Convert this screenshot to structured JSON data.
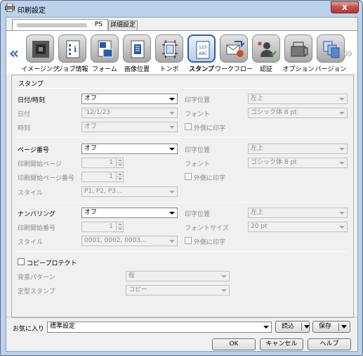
{
  "window": {
    "title": "印刷設定",
    "close_label": "x"
  },
  "tabs": [
    {
      "label": "PS"
    },
    {
      "label": "詳細設定"
    }
  ],
  "categories": [
    {
      "label": "イメージング",
      "icon": "imaging-icon"
    },
    {
      "label": "ジョブ情報",
      "icon": "job-info-icon"
    },
    {
      "label": "フォーム",
      "icon": "form-icon"
    },
    {
      "label": "画像位置",
      "icon": "image-position-icon"
    },
    {
      "label": "トンボ",
      "icon": "crop-marks-icon"
    },
    {
      "label": "スタンプ",
      "icon": "stamp-icon",
      "active": true
    },
    {
      "label": "ワークフロー",
      "icon": "workflow-icon"
    },
    {
      "label": "認証",
      "icon": "authentication-icon"
    },
    {
      "label": "オプション",
      "icon": "option-icon"
    },
    {
      "label": "バージョン",
      "icon": "version-icon"
    }
  ],
  "nav": {
    "left": "«",
    "right": "»"
  },
  "panel": {
    "title": "スタンプ",
    "datetime": {
      "label": "日付/時刻",
      "value": "オフ",
      "date_label": "日付",
      "date_value": "'12/1/23",
      "time_label": "時刻",
      "time_value": "オフ",
      "position_label": "印字位置",
      "position_value": "左上",
      "font_label": "フォント",
      "font_value": "ゴシック体 8 pt",
      "outside_label": "外側に印字"
    },
    "page_number": {
      "label": "ページ番号",
      "value": "オフ",
      "start_page_label": "印刷開始ページ",
      "start_page_value": "1",
      "start_number_label": "印刷開始ページ番号",
      "start_number_value": "1",
      "style_label": "スタイル",
      "style_value": "P1, P2, P3...",
      "position_label": "印字位置",
      "position_value": "左上",
      "font_label": "フォント",
      "font_value": "ゴシック体 8 pt",
      "outside_label": "外側に印字"
    },
    "numbering": {
      "label": "ナンバリング",
      "value": "オフ",
      "start_label": "印刷開始番号",
      "start_value": "1",
      "style_label": "スタイル",
      "style_value": "0001, 0002, 0003...",
      "position_label": "印字位置",
      "position_value": "左上",
      "font_size_label": "フォントサイズ",
      "font_size_value": "20 pt",
      "outside_label": "外側に印字"
    },
    "copy_protect": {
      "label": "コピープロテクト",
      "pattern_label": "背景パターン",
      "pattern_value": "桜",
      "stamp_label": "定型スタンプ",
      "stamp_value": "コピー"
    }
  },
  "favorites": {
    "label": "お気に入り",
    "value": "標準設定",
    "load_label": "読込",
    "save_label": "保存"
  },
  "buttons": {
    "ok": "OK",
    "cancel": "キャンセル",
    "help": "ヘルプ"
  }
}
